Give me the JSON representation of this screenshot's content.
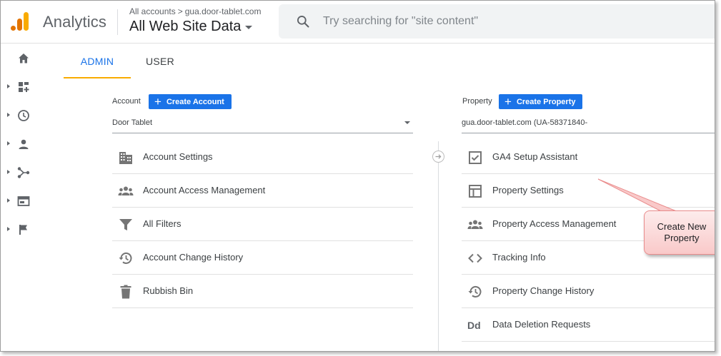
{
  "header": {
    "app_name": "Analytics",
    "breadcrumb": {
      "root": "All accounts",
      "separator": ">",
      "account": "gua.door-tablet.com"
    },
    "view_name": "All Web Site Data",
    "search_placeholder": "Try searching for \"site content\""
  },
  "left_nav": {
    "items": [
      {
        "icon": "home-icon",
        "has_arrow": false
      },
      {
        "icon": "customization-icon",
        "has_arrow": true
      },
      {
        "icon": "clock-icon",
        "has_arrow": true
      },
      {
        "icon": "person-icon",
        "has_arrow": true
      },
      {
        "icon": "acquisition-icon",
        "has_arrow": true
      },
      {
        "icon": "behavior-icon",
        "has_arrow": true
      },
      {
        "icon": "flag-icon",
        "has_arrow": true
      }
    ]
  },
  "tabs": [
    {
      "label": "ADMIN",
      "active": true
    },
    {
      "label": "USER",
      "active": false
    }
  ],
  "account_column": {
    "label": "Account",
    "create_button": "Create Account",
    "selected": "Door Tablet",
    "items": [
      {
        "label": "Account Settings",
        "icon": "building-icon"
      },
      {
        "label": "Account Access Management",
        "icon": "people-icon"
      },
      {
        "label": "All Filters",
        "icon": "filter-icon"
      },
      {
        "label": "Account Change History",
        "icon": "history-icon"
      },
      {
        "label": "Rubbish Bin",
        "icon": "trash-icon"
      }
    ]
  },
  "property_column": {
    "label": "Property",
    "create_button": "Create Property",
    "selected": "gua.door-tablet.com (UA-58371840-",
    "items": [
      {
        "label": "GA4 Setup Assistant",
        "icon": "checkbox-icon"
      },
      {
        "label": "Property Settings",
        "icon": "layout-icon"
      },
      {
        "label": "Property Access Management",
        "icon": "people-icon"
      },
      {
        "label": "Tracking Info",
        "icon": "code-icon"
      },
      {
        "label": "Property Change History",
        "icon": "history-icon"
      },
      {
        "label": "Data Deletion Requests",
        "icon": "dd-icon",
        "icon_text": "Dd"
      }
    ]
  },
  "callout": {
    "line1": "Create New",
    "line2": "Property"
  },
  "colors": {
    "accent_blue": "#1a73e8",
    "tab_underline": "#f9ab00",
    "logo_orange": "#f9ab00",
    "logo_dark_orange": "#e37400",
    "callout_fill": "#fbd3d3",
    "callout_border": "#e98c8c"
  }
}
